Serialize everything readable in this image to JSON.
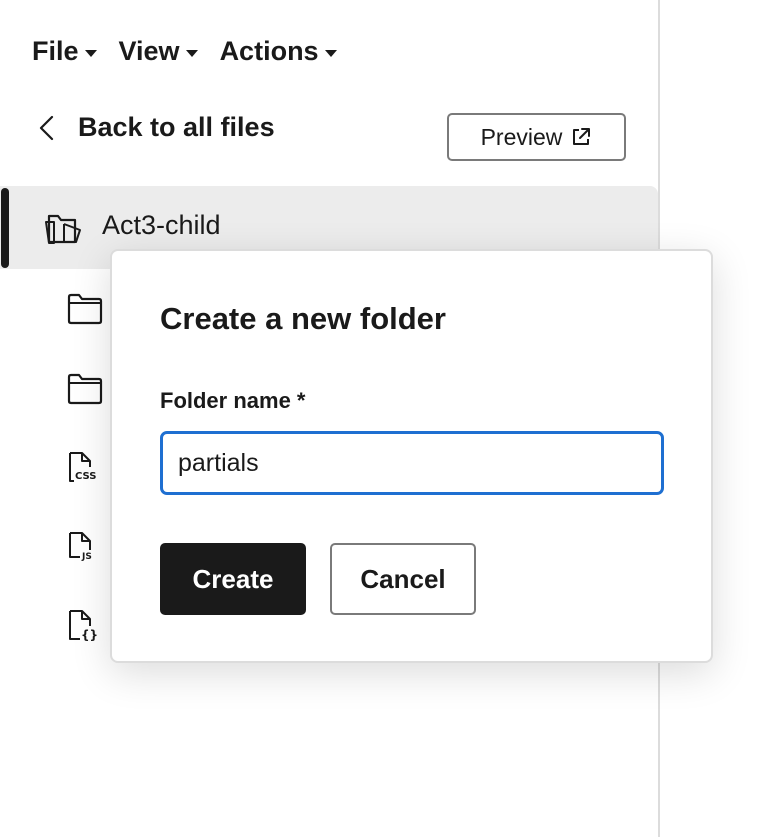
{
  "menubar": {
    "items": [
      {
        "label": "File",
        "icon": "caret-down-icon"
      },
      {
        "label": "View",
        "icon": "caret-down-icon"
      },
      {
        "label": "Actions",
        "icon": "caret-down-icon"
      }
    ]
  },
  "nav": {
    "back_label": "Back to all files",
    "back_icon": "chevron-left-icon",
    "preview_label": "Preview",
    "preview_icon": "external-link-icon"
  },
  "tree": {
    "root_label": "Act3-child",
    "root_icon": "theme-folder-icon",
    "items": [
      {
        "icon": "folder-icon"
      },
      {
        "icon": "folder-icon"
      },
      {
        "icon": "css-file-icon",
        "glyph": "CSS"
      },
      {
        "icon": "js-file-icon",
        "glyph": "JS"
      },
      {
        "icon": "json-file-icon",
        "glyph": "{}"
      }
    ]
  },
  "dialog": {
    "title": "Create a new folder",
    "field_label": "Folder name *",
    "field_value": "partials",
    "create_label": "Create",
    "cancel_label": "Cancel"
  },
  "colors": {
    "accent_focus": "#1e6fd1",
    "primary_button": "#1a1a1a",
    "selected_row": "#ececec"
  }
}
